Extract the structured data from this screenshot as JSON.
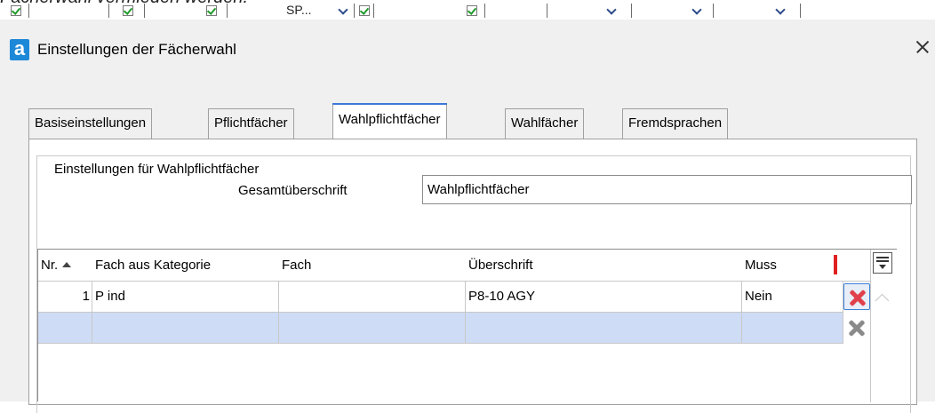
{
  "background": {
    "partial_text": "Fächerwahl vermieden werden.",
    "sp_cell": "SP..."
  },
  "dialog": {
    "app_icon_letter": "a",
    "title": "Einstellungen der Fächerwahl",
    "close_icon": "close-icon"
  },
  "tabs": [
    {
      "label": "Basiseinstellungen",
      "active": false
    },
    {
      "label": "Pflichtfächer",
      "active": false
    },
    {
      "label": "Wahlpflichtfächer",
      "active": true
    },
    {
      "label": "Wahlfächer",
      "active": false
    },
    {
      "label": "Fremdsprachen",
      "active": false
    }
  ],
  "group": {
    "title": "Einstellungen für Wahlpflichtfächer",
    "gesamt_label": "Gesamtüberschrift",
    "gesamt_value": "Wahlpflichtfächer"
  },
  "grid": {
    "columns": [
      "Nr.",
      "Fach aus Kategorie",
      "Fach",
      "Überschrift",
      "Muss"
    ],
    "sort_column": "Nr.",
    "sort_direction": "ascending",
    "rows": [
      {
        "nr": "1",
        "kategorie": "P ind",
        "fach": "",
        "ueberschrift": "P8-10 AGY",
        "muss": "Nein"
      }
    ],
    "new_row_highlight": "#cfdcf5"
  },
  "colors": {
    "accent": "#3b78d8",
    "app_icon": "#1e88d8",
    "delete_red": "#e0404c",
    "marker_red": "#e02020"
  }
}
